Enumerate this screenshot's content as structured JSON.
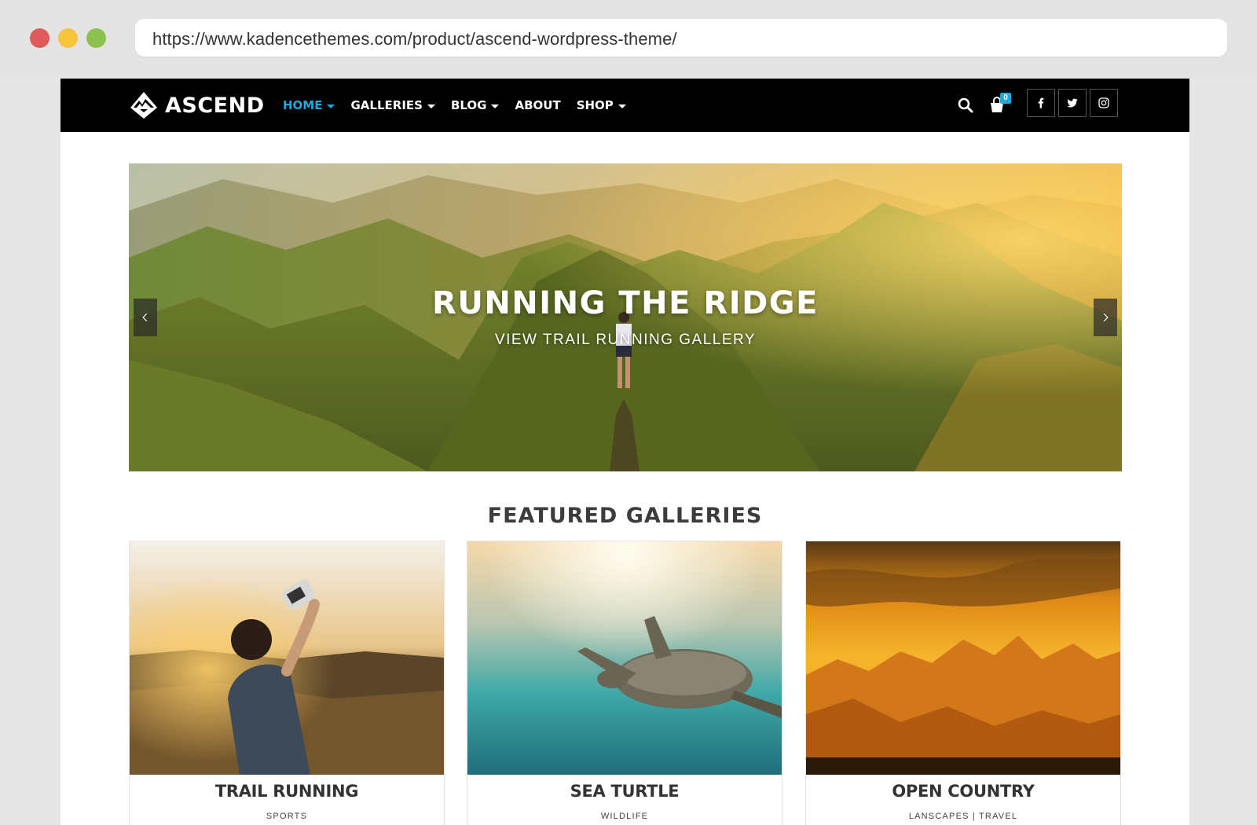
{
  "browser": {
    "url": "https://www.kadencethemes.com/product/ascend-wordpress-theme/"
  },
  "header": {
    "logo_text": "ASCEND",
    "nav": [
      {
        "label": "HOME",
        "active": true,
        "has_caret": true
      },
      {
        "label": "GALLERIES",
        "active": false,
        "has_caret": true
      },
      {
        "label": "BLOG",
        "active": false,
        "has_caret": true
      },
      {
        "label": "ABOUT",
        "active": false,
        "has_caret": false
      },
      {
        "label": "SHOP",
        "active": false,
        "has_caret": true
      }
    ],
    "cart_count": "0",
    "icons": [
      "search-icon",
      "cart-icon",
      "facebook-icon",
      "twitter-icon",
      "instagram-icon"
    ],
    "accent_color": "#1fa9e1"
  },
  "hero": {
    "title": "RUNNING THE RIDGE",
    "subtitle": "VIEW TRAIL RUNNING GALLERY",
    "prev_icon": "chevron-left-icon",
    "next_icon": "chevron-right-icon"
  },
  "featured": {
    "heading": "FEATURED GALLERIES",
    "cards": [
      {
        "title": "TRAIL RUNNING",
        "category": "SPORTS"
      },
      {
        "title": "SEA TURTLE",
        "category": "WILDLIFE"
      },
      {
        "title": "OPEN COUNTRY",
        "category": "LANSCAPES | TRAVEL"
      }
    ]
  }
}
